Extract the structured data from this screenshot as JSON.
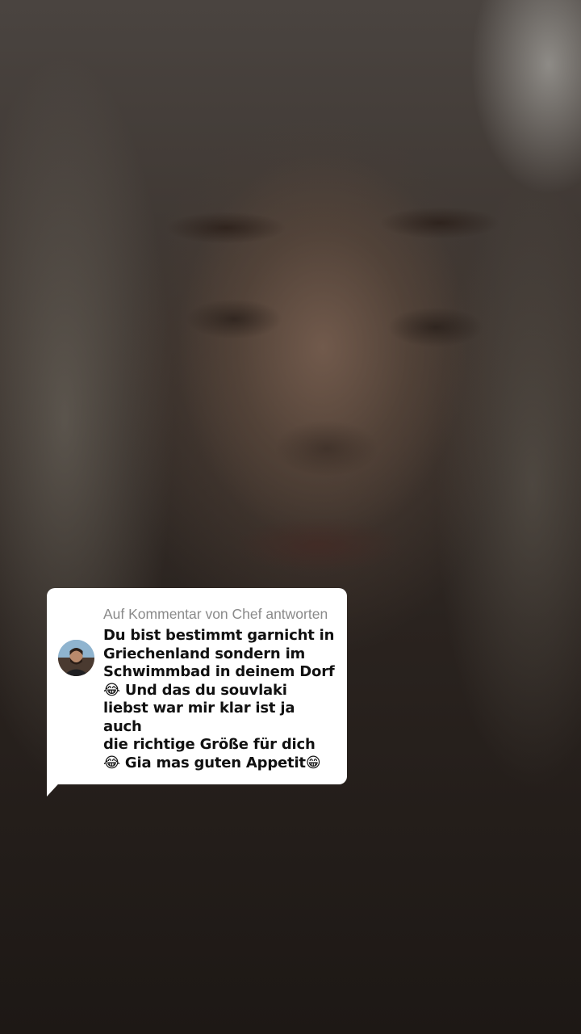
{
  "reply_card": {
    "header": "Auf Kommentar von Chef antworten",
    "comment_lines": [
      "Du bist bestimmt garnicht in",
      "Griechenland sondern im",
      "Schwimmbad in deinem Dorf",
      "😂 Und das du souvlaki",
      "liebst war mir klar ist ja auch",
      "die richtige Größe für dich",
      "😂 Gia mas guten Appetit😁"
    ],
    "avatar_icon": "commenter-avatar",
    "background_color": "#ffffff",
    "header_color": "#8a8a8a",
    "text_color": "#111111"
  }
}
